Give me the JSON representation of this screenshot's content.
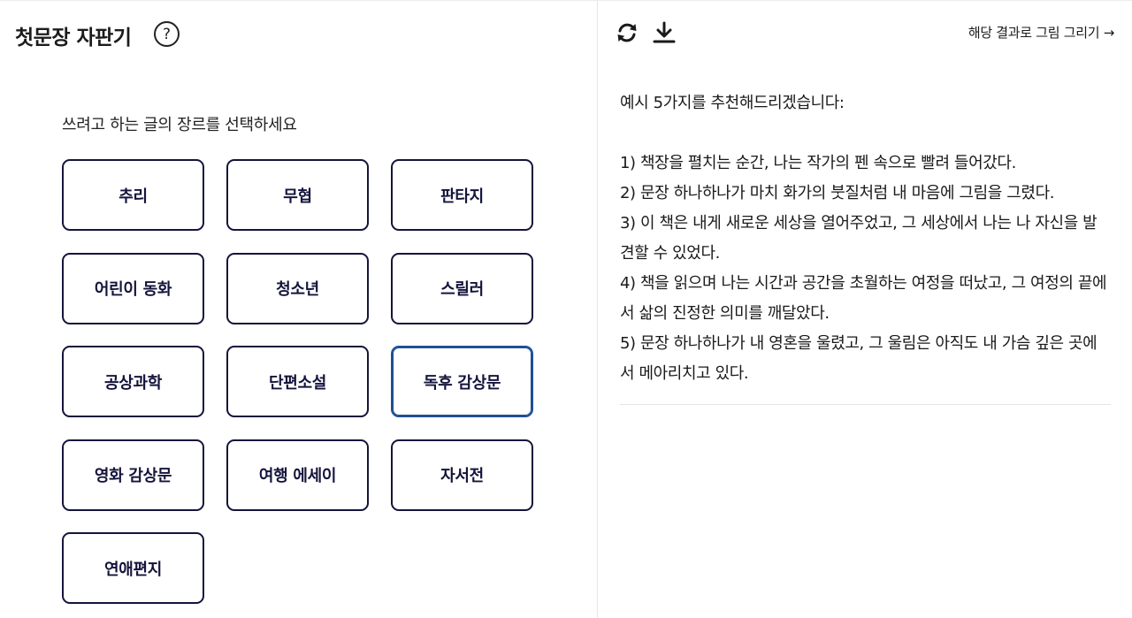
{
  "header": {
    "title": "첫문장 자판기",
    "help_icon": "?"
  },
  "selector": {
    "prompt": "쓰려고 하는 글의 장르를 선택하세요",
    "genres": [
      "추리",
      "무협",
      "판타지",
      "어린이 동화",
      "청소년",
      "스릴러",
      "공상과학",
      "단편소설",
      "독후 감상문",
      "영화 감상문",
      "여행 에세이",
      "자서전",
      "연애편지"
    ],
    "selected": "독후 감상문"
  },
  "result": {
    "toolbar": {
      "refresh_icon": "refresh-icon",
      "download_icon": "download-icon"
    },
    "draw_link": "해당 결과로 그림 그리기 →",
    "intro": "예시 5가지를 추천해드리겠습니다:",
    "lines": [
      "1) 책장을 펼치는 순간, 나는 작가의 펜 속으로 빨려 들어갔다.",
      "2) 문장 하나하나가 마치 화가의 붓질처럼 내 마음에 그림을 그렸다.",
      "3) 이 책은 내게 새로운 세상을 열어주었고, 그 세상에서 나는 나 자신을 발견할 수 있었다.",
      "4) 책을 읽으며 나는 시간과 공간을 초월하는 여정을 떠났고, 그 여정의 끝에서 삶의 진정한 의미를 깨달았다.",
      "5) 문장 하나하나가 내 영혼을 울렸고, 그 울림은 아직도 내 가슴 깊은 곳에서 메아리치고 있다."
    ]
  },
  "colors": {
    "button_border": "#14143c",
    "selected_border": "#1e4f94"
  }
}
